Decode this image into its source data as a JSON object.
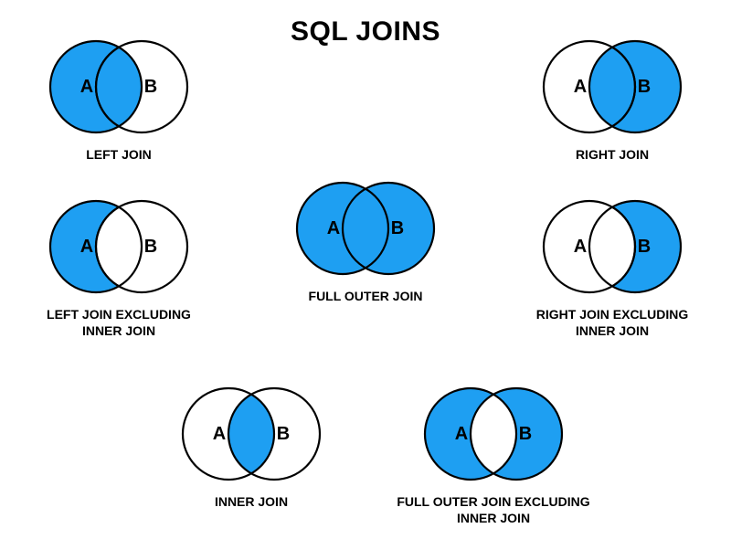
{
  "title": "SQL JOINS",
  "colors": {
    "fill": "#1E9FF2",
    "bg": "#ffffff",
    "stroke": "#000000"
  },
  "labels": {
    "A": "A",
    "B": "B"
  },
  "diagrams": {
    "left_join": {
      "caption": "LEFT JOIN"
    },
    "right_join": {
      "caption": "RIGHT JOIN"
    },
    "full_outer": {
      "caption": "FULL OUTER JOIN"
    },
    "left_excl": {
      "caption": "LEFT JOIN EXCLUDING\nINNER JOIN"
    },
    "right_excl": {
      "caption": "RIGHT JOIN EXCLUDING\nINNER JOIN"
    },
    "inner_join": {
      "caption": "INNER JOIN"
    },
    "full_excl": {
      "caption": "FULL OUTER JOIN EXCLUDING\nINNER JOIN"
    }
  }
}
